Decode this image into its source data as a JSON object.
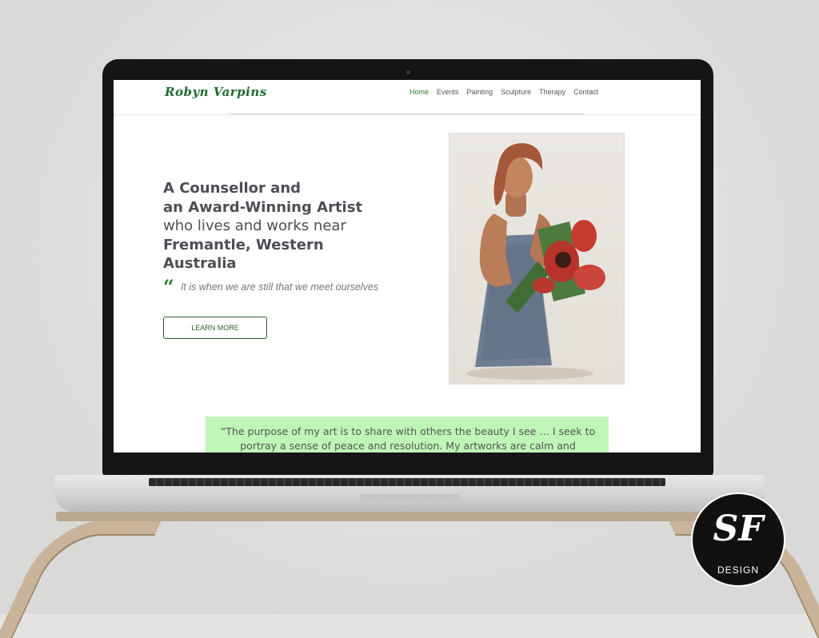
{
  "site": {
    "logo": "Robyn Varpins",
    "nav": [
      "Home",
      "Events",
      "Painting",
      "Sculpture",
      "Therapy",
      "Contact"
    ],
    "active_nav": "Home"
  },
  "hero": {
    "line1": "A Counsellor and",
    "line2": "an Award-Winning Artist",
    "line3": "who lives and works near",
    "line4": "Fremantle, Western",
    "line5": "Australia",
    "quote_icon": "“",
    "quote": "It is when we are still that we meet ourselves",
    "button": "LEARN MORE"
  },
  "band": {
    "text": "“The purpose of my art is to share with others the beauty I see … I seek to portray a sense of peace and resolution. My artworks are calm and"
  },
  "badge": {
    "monogram": "SF",
    "label": "DESIGN"
  },
  "colors": {
    "accent_green": "#2e7d32",
    "band_green": "#bff5b7",
    "text_gray": "#4b4f55"
  },
  "icons": {
    "quote": "quote-icon",
    "artwork": "sculpture-image"
  }
}
